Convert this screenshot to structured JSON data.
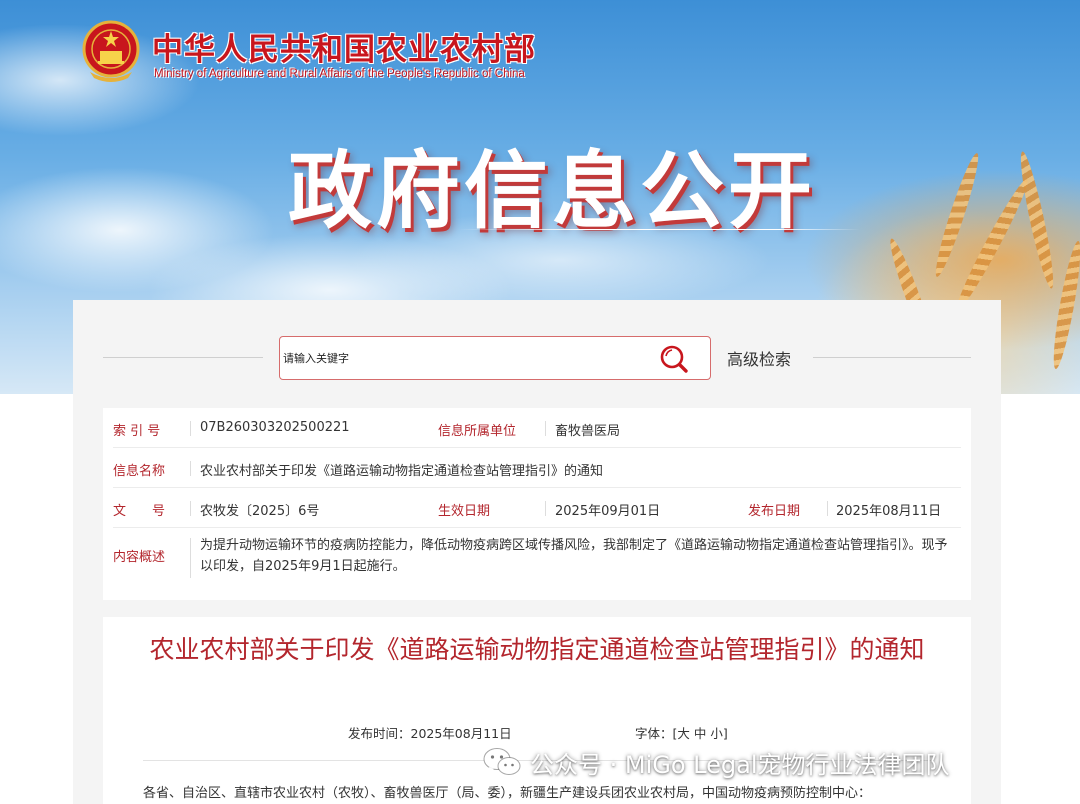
{
  "header": {
    "site_title": "中华人民共和国农业农村部",
    "site_subtitle": "Ministry of Agriculture and Rural Affairs of the People's Republic of China",
    "banner_title": "政府信息公开"
  },
  "search": {
    "placeholder": "请输入关键字",
    "advanced_label": "高级检索"
  },
  "meta": {
    "index_label": "索 引 号",
    "index_value": "07B260303202500221",
    "unit_label": "信息所属单位",
    "unit_value": "畜牧兽医局",
    "name_label": "信息名称",
    "name_value": "农业农村部关于印发《道路运输动物指定通道检查站管理指引》的通知",
    "doc_no_label": "文　　号",
    "doc_no_value": "农牧发〔2025〕6号",
    "effective_label": "生效日期",
    "effective_value": "2025年09月01日",
    "publish_label": "发布日期",
    "publish_value": "2025年08月11日",
    "summary_label": "内容概述",
    "summary_value": "为提升动物运输环节的疫病防控能力，降低动物疫病跨区域传播风险，我部制定了《道路运输动物指定通道检查站管理指引》。现予以印发，自2025年9月1日起施行。"
  },
  "document": {
    "title": "农业农村部关于印发《道路运输动物指定通道检查站管理指引》的通知",
    "publish_time": "发布时间：2025年08月11日",
    "font_size_label": "字体：[大 中 小]",
    "body_first_line": "各省、自治区、直辖市农业农村（农牧）、畜牧兽医厅（局、委），新疆生产建设兵团农业农村局，中国动物疫病预防控制中心："
  },
  "watermark": {
    "text": "公众号 · MiGo Legal宠物行业法律团队"
  },
  "colors": {
    "brand_red": "#c8161d",
    "label_red": "#b3262d",
    "panel_bg": "#f4f4f4"
  }
}
